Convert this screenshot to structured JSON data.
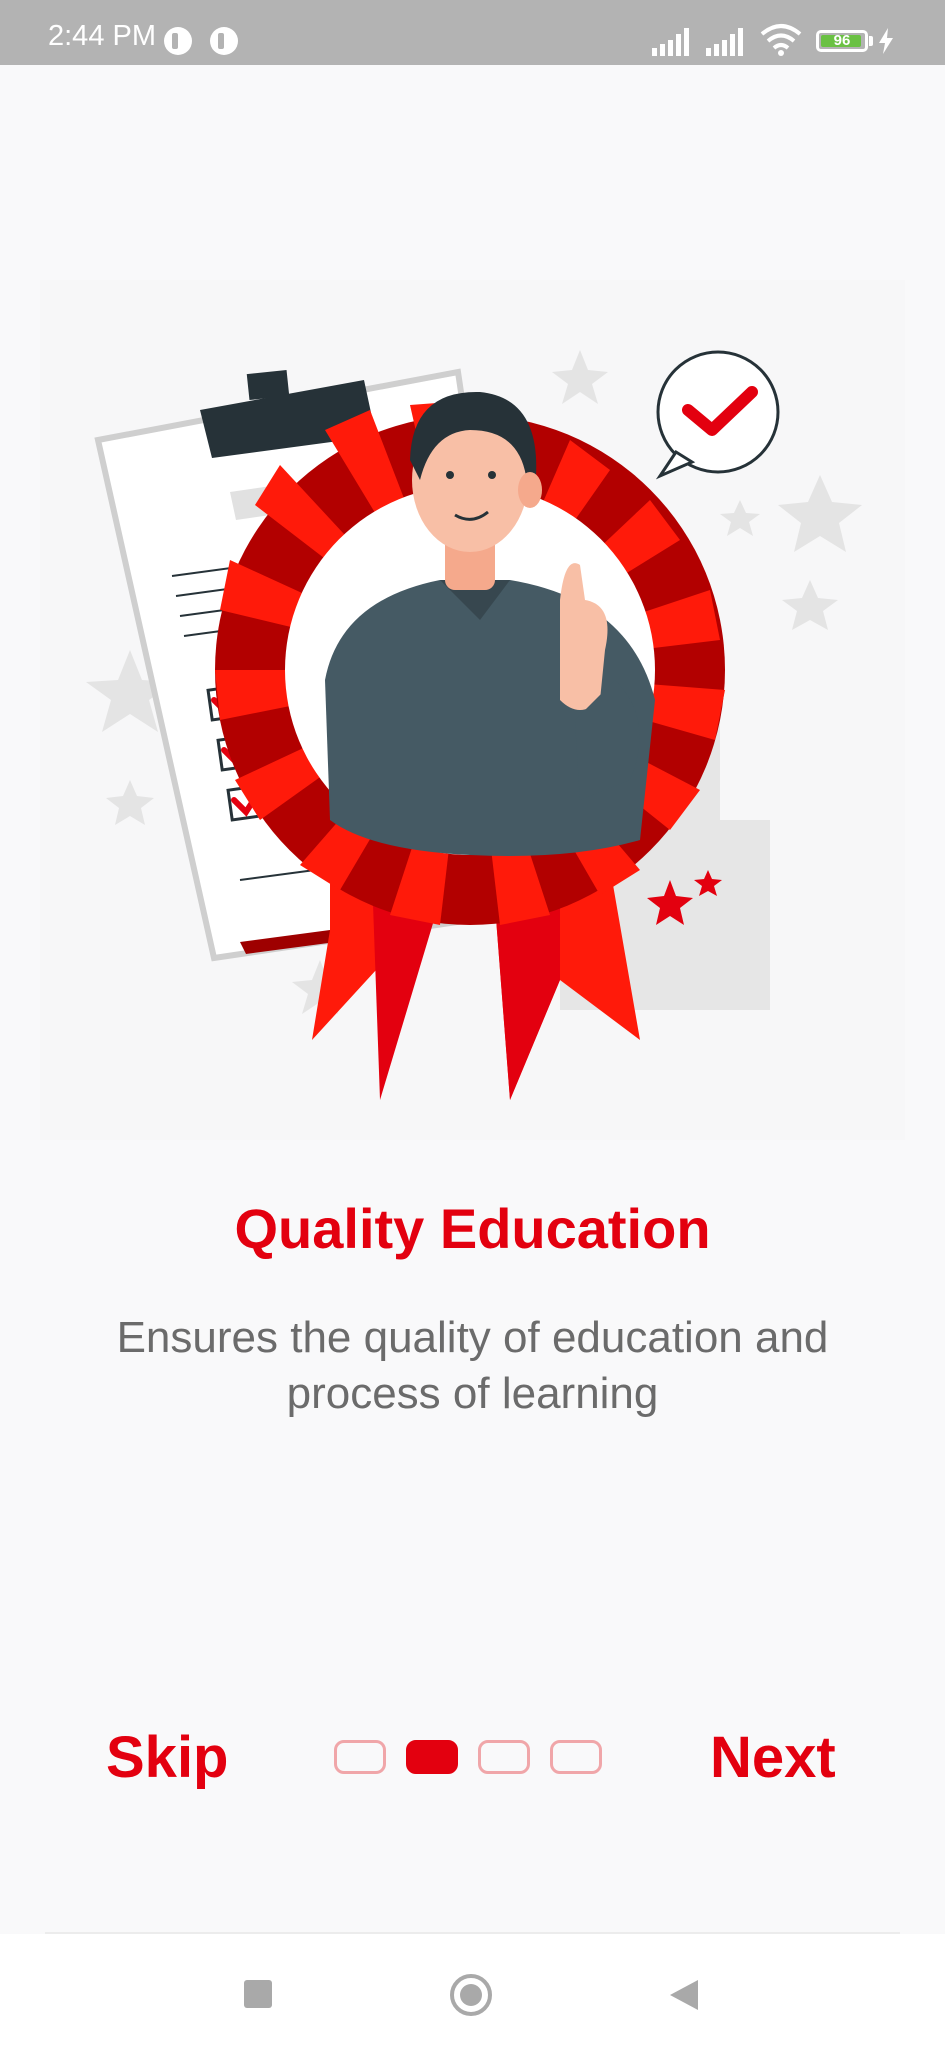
{
  "status_bar": {
    "time": "2:44 PM",
    "battery_level": "96",
    "battery_fraction": 0.96,
    "icons": [
      "app-notification-icon",
      "app-notification-icon",
      "signal-icon",
      "signal-icon",
      "wifi-icon",
      "battery-icon",
      "charging-icon"
    ]
  },
  "onboarding": {
    "illustration": "award-ribbon-illustration",
    "title": "Quality Education",
    "description": "Ensures the quality of education and process of learning",
    "skip_label": "Skip",
    "next_label": "Next",
    "page_count": 4,
    "current_page": 2
  },
  "navigation_bar": {
    "icons": [
      "recents-icon",
      "home-icon",
      "back-icon"
    ]
  },
  "colors": {
    "accent": "#e3000f",
    "inactive_dot": "#f0a6a9",
    "text_secondary": "#6b6b6b",
    "background": "#f9f9fa"
  }
}
